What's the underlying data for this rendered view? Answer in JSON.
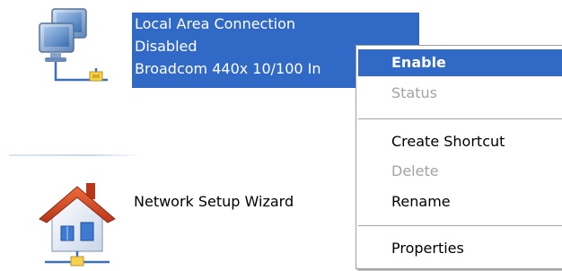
{
  "connection": {
    "name": "Local Area Connection",
    "status": "Disabled",
    "device": "Broadcom 440x 10/100 In"
  },
  "wizard": {
    "label": "Network Setup Wizard"
  },
  "context_menu": {
    "items": [
      {
        "label": "Enable",
        "state": "highlighted"
      },
      {
        "label": "Status",
        "state": "disabled"
      },
      {
        "label": "Create Shortcut",
        "state": "enabled"
      },
      {
        "label": "Delete",
        "state": "disabled"
      },
      {
        "label": "Rename",
        "state": "enabled"
      },
      {
        "label": "Properties",
        "state": "enabled"
      }
    ]
  },
  "icons": {
    "connection": "network-computers-icon",
    "wizard": "home-network-icon"
  },
  "colors": {
    "selection": "#3169c6",
    "disabled_text": "#a3a3a3",
    "menu_border": "#a0a0a0"
  }
}
